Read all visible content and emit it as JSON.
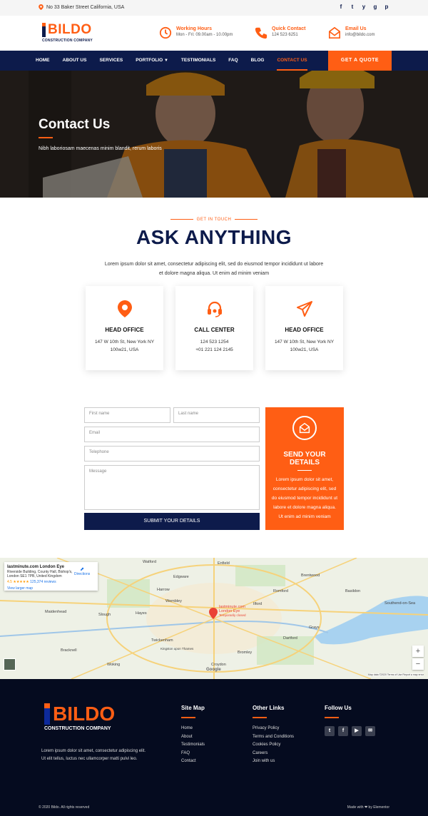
{
  "topbar": {
    "address": "No 33 Baker Street California, USA",
    "social": [
      "f",
      "t",
      "y",
      "g",
      "p"
    ]
  },
  "header": {
    "logo_text": "BILDO",
    "logo_sub": "CONSTRUCTION COMPANY",
    "hours_label": "Working Hours",
    "hours_value": "Mon - Fri: 09.00am - 10.00pm",
    "contact_label": "Quick Contact",
    "contact_value": "124 523 6251",
    "email_label": "Email Us",
    "email_value": "info@bildo.com"
  },
  "nav": {
    "items": [
      "HOME",
      "ABOUT US",
      "SERVICES",
      "PORTFOLIO",
      "TESTIMONIALS",
      "FAQ",
      "BLOG",
      "CONTACT US"
    ],
    "quote_label": "GET A QUOTE"
  },
  "hero": {
    "title": "Contact Us",
    "subtitle": "Nibh laboriosam maecenas minim blandit, rerum laboris"
  },
  "intro": {
    "eyebrow": "GET IN TOUCH",
    "title": "ASK ANYTHING",
    "lead": "Lorem ipsum dolor sit amet, consectetur adipiscing elit, sed do eiusmod tempor incididunt ut labore et dolore magna aliqua. Ut enim ad minim veniam"
  },
  "cards": [
    {
      "title": "HEAD OFFICE",
      "line1": "147 W 10th St, New York NY",
      "line2": "100w21, USA"
    },
    {
      "title": "CALL CENTER",
      "line1": "124 523 1254",
      "line2": "+01 221 124 2145"
    },
    {
      "title": "HEAD OFFICE",
      "line1": "147 W 10th St, New York NY",
      "line2": "100w21, USA"
    }
  ],
  "form": {
    "first_name": "First name",
    "last_name": "Last name",
    "email": "Email",
    "telephone": "Telephone",
    "message": "Message",
    "submit": "SUBMIT YOUR DETAILS"
  },
  "sendbox": {
    "title_line1": "SEND YOUR",
    "title_line2": "DETAILS",
    "text": "Lorem ipsum dolor sit amet, consectetur adipiscing elit, sed do eiusmod tempor incididunt ut labore et dolore magna aliqua. Ut enim ad minim veniam"
  },
  "map": {
    "place": "lastminute.com London Eye",
    "address": "Riverside Building, County Hall, Bishop's, London SE1 7PB, United Kingdom",
    "rating": "4.5",
    "stars": "★★★★★",
    "reviews": "125,374 reviews",
    "larger": "View larger map",
    "directions": "Directions",
    "pin_label": "lastminute.com London Eye",
    "pin_sub": "Temporarily closed",
    "towns": [
      "Watford",
      "Enfield",
      "Edgware",
      "Harrow",
      "Wembley",
      "Slough",
      "Hayes",
      "Twickenham",
      "Croydon",
      "Bromley",
      "Romford",
      "Ilford",
      "Brentwood",
      "Basildon",
      "Southend-on-Sea",
      "Dartford",
      "Maidenhead",
      "Bracknell",
      "Woking",
      "Kingston upon Thames",
      "Grays"
    ],
    "credit": "Map data ©2020   Terms of Use   Report a map error",
    "google": "Google"
  },
  "footer": {
    "logo_text": "BILDO",
    "logo_sub": "CONSTRUCTION COMPANY",
    "text": "Lorem ipsum dolor sit amet, consectetur adipiscing elit. Ut elit tellus, luctus nec ullamcorper matti pulvi leo.",
    "sitemap_title": "Site Map",
    "sitemap": [
      "Home",
      "About",
      "Testimonials",
      "FAQ",
      "Contact"
    ],
    "links_title": "Other Links",
    "links": [
      "Privacy Policy",
      "Terms and Conditions",
      "Cookies Policy",
      "Careers",
      "Join with us"
    ],
    "follow_title": "Follow Us",
    "social": [
      "t",
      "f",
      "▶",
      "✉"
    ],
    "copyright": "© 2020 Bildo. All rights reserved",
    "made_with": "Made with ❤ by Elementor"
  },
  "colors": {
    "accent": "#ff5e14",
    "navy": "#0d1b4b",
    "footer": "#050b1f"
  }
}
